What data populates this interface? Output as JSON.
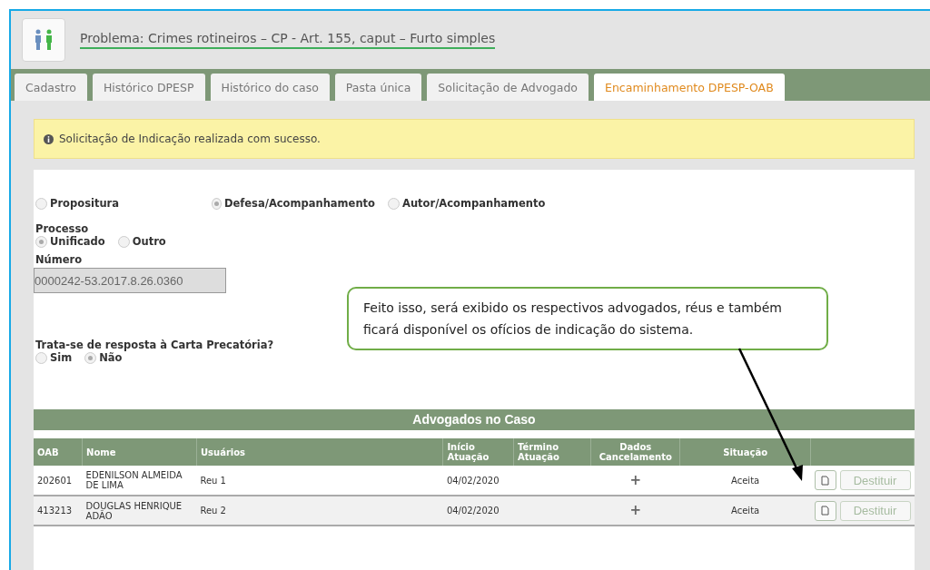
{
  "header": {
    "title": "Problema: Crimes rotineiros – CP - Art. 155, caput – Furto simples"
  },
  "tabs": [
    {
      "label": "Cadastro",
      "selected": false
    },
    {
      "label": "Histórico DPESP",
      "selected": false
    },
    {
      "label": "Histórico do caso",
      "selected": false
    },
    {
      "label": "Pasta única",
      "selected": false
    },
    {
      "label": "Solicitação de Advogado",
      "selected": false
    },
    {
      "label": "Encaminhamento DPESP-OAB",
      "selected": true
    }
  ],
  "alert": {
    "message": "Solicitação de Indicação realizada com sucesso."
  },
  "type_options": [
    {
      "label": "Propositura",
      "selected": false
    },
    {
      "label": "Defesa/Acompanhamento",
      "selected": true
    },
    {
      "label": "Autor/Acompanhamento",
      "selected": false
    }
  ],
  "processo": {
    "label": "Processo",
    "options": [
      {
        "label": "Unificado",
        "selected": true
      },
      {
        "label": "Outro",
        "selected": false
      }
    ]
  },
  "numero": {
    "label": "Número",
    "value": "0000242-53.2017.8.26.0360"
  },
  "carta": {
    "label": "Trata-se de resposta à Carta Precatória?",
    "options": [
      {
        "label": "Sim",
        "selected": false
      },
      {
        "label": "Não",
        "selected": true
      }
    ]
  },
  "table": {
    "title": "Advogados no Caso",
    "columns": [
      "OAB",
      "Nome",
      "Usuários",
      "Início Atuação",
      "Término Atuação",
      "Dados Cancelamento",
      "Situação"
    ],
    "rows": [
      {
        "oab": "202601",
        "nome": "EDENILSON ALMEIDA DE LIMA",
        "usuarios": "Reu 1",
        "inicio": "04/02/2020",
        "cancel": "+",
        "situacao": "Aceita",
        "action": "Destituir"
      },
      {
        "oab": "413213",
        "nome": "DOUGLAS HENRIQUE ADÃO",
        "usuarios": "Reu 2",
        "inicio": "04/02/2020",
        "cancel": "+",
        "situacao": "Aceita",
        "action": "Destituir"
      }
    ]
  },
  "callout": {
    "text": "Feito isso, será exibido os respectivos advogados, réus e também ficará disponível os ofícios de indicação do sistema."
  }
}
